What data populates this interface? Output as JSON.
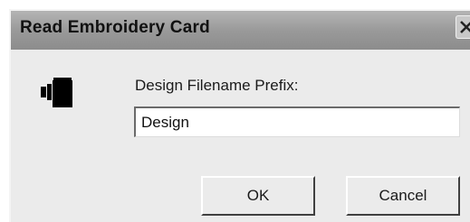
{
  "window": {
    "title": "Read Embroidery Card"
  },
  "form": {
    "prefix_label": "Design Filename Prefix:",
    "prefix_value": "Design"
  },
  "buttons": {
    "ok_label": "OK",
    "cancel_label": "Cancel"
  },
  "icons": {
    "card": "embroidery-card-icon",
    "close": "close-icon"
  }
}
